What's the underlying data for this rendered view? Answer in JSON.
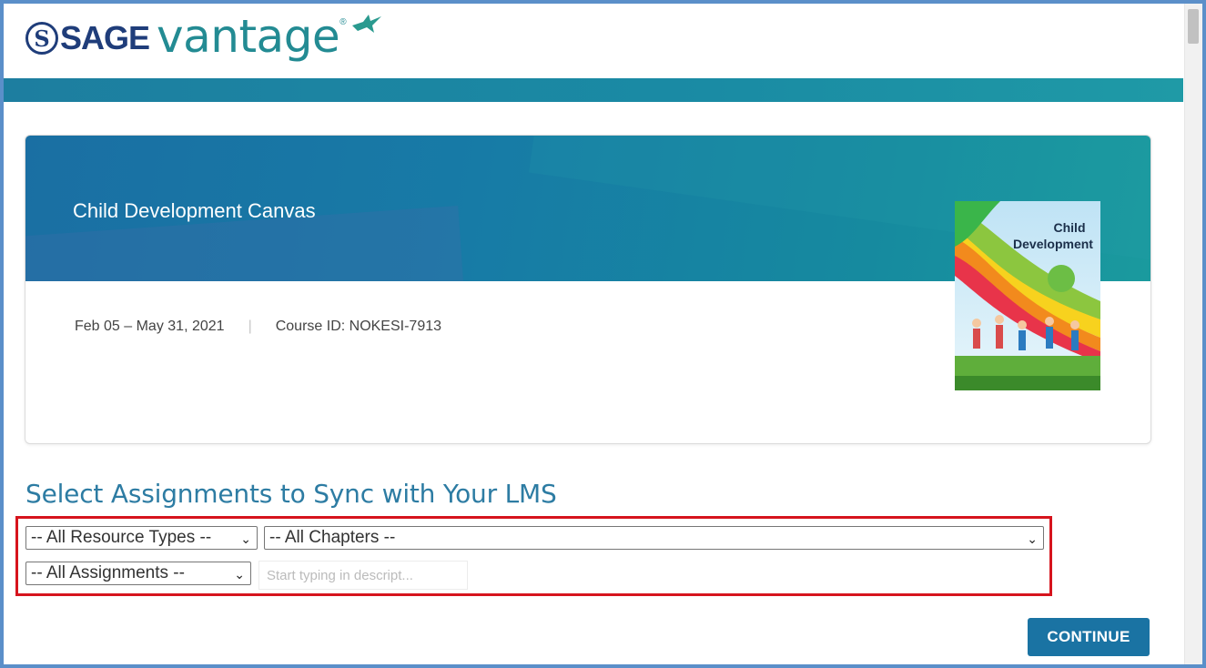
{
  "header": {
    "logo_sage": "SAGE",
    "logo_sage_mark": "S",
    "logo_vantage": "vantage",
    "logo_reg": "®"
  },
  "course": {
    "title": "Child Development Canvas",
    "dates": "Feb 05 – May 31, 2021",
    "separator": "|",
    "course_id": "Course ID: NOKESI-7913",
    "book_cover_title": "Child Development"
  },
  "section": {
    "title": "Select Assignments to Sync with Your LMS"
  },
  "filters": {
    "resource_types": "-- All Resource Types --",
    "chapters": "-- All Chapters --",
    "assignments": "-- All Assignments --",
    "search_placeholder": "Start typing in descript..."
  },
  "actions": {
    "continue_label": "CONTINUE"
  },
  "colors": {
    "accent": "#1a73a3",
    "banner": "#177ba6",
    "highlight_box": "#d6141d",
    "title": "#2d7ca3"
  }
}
